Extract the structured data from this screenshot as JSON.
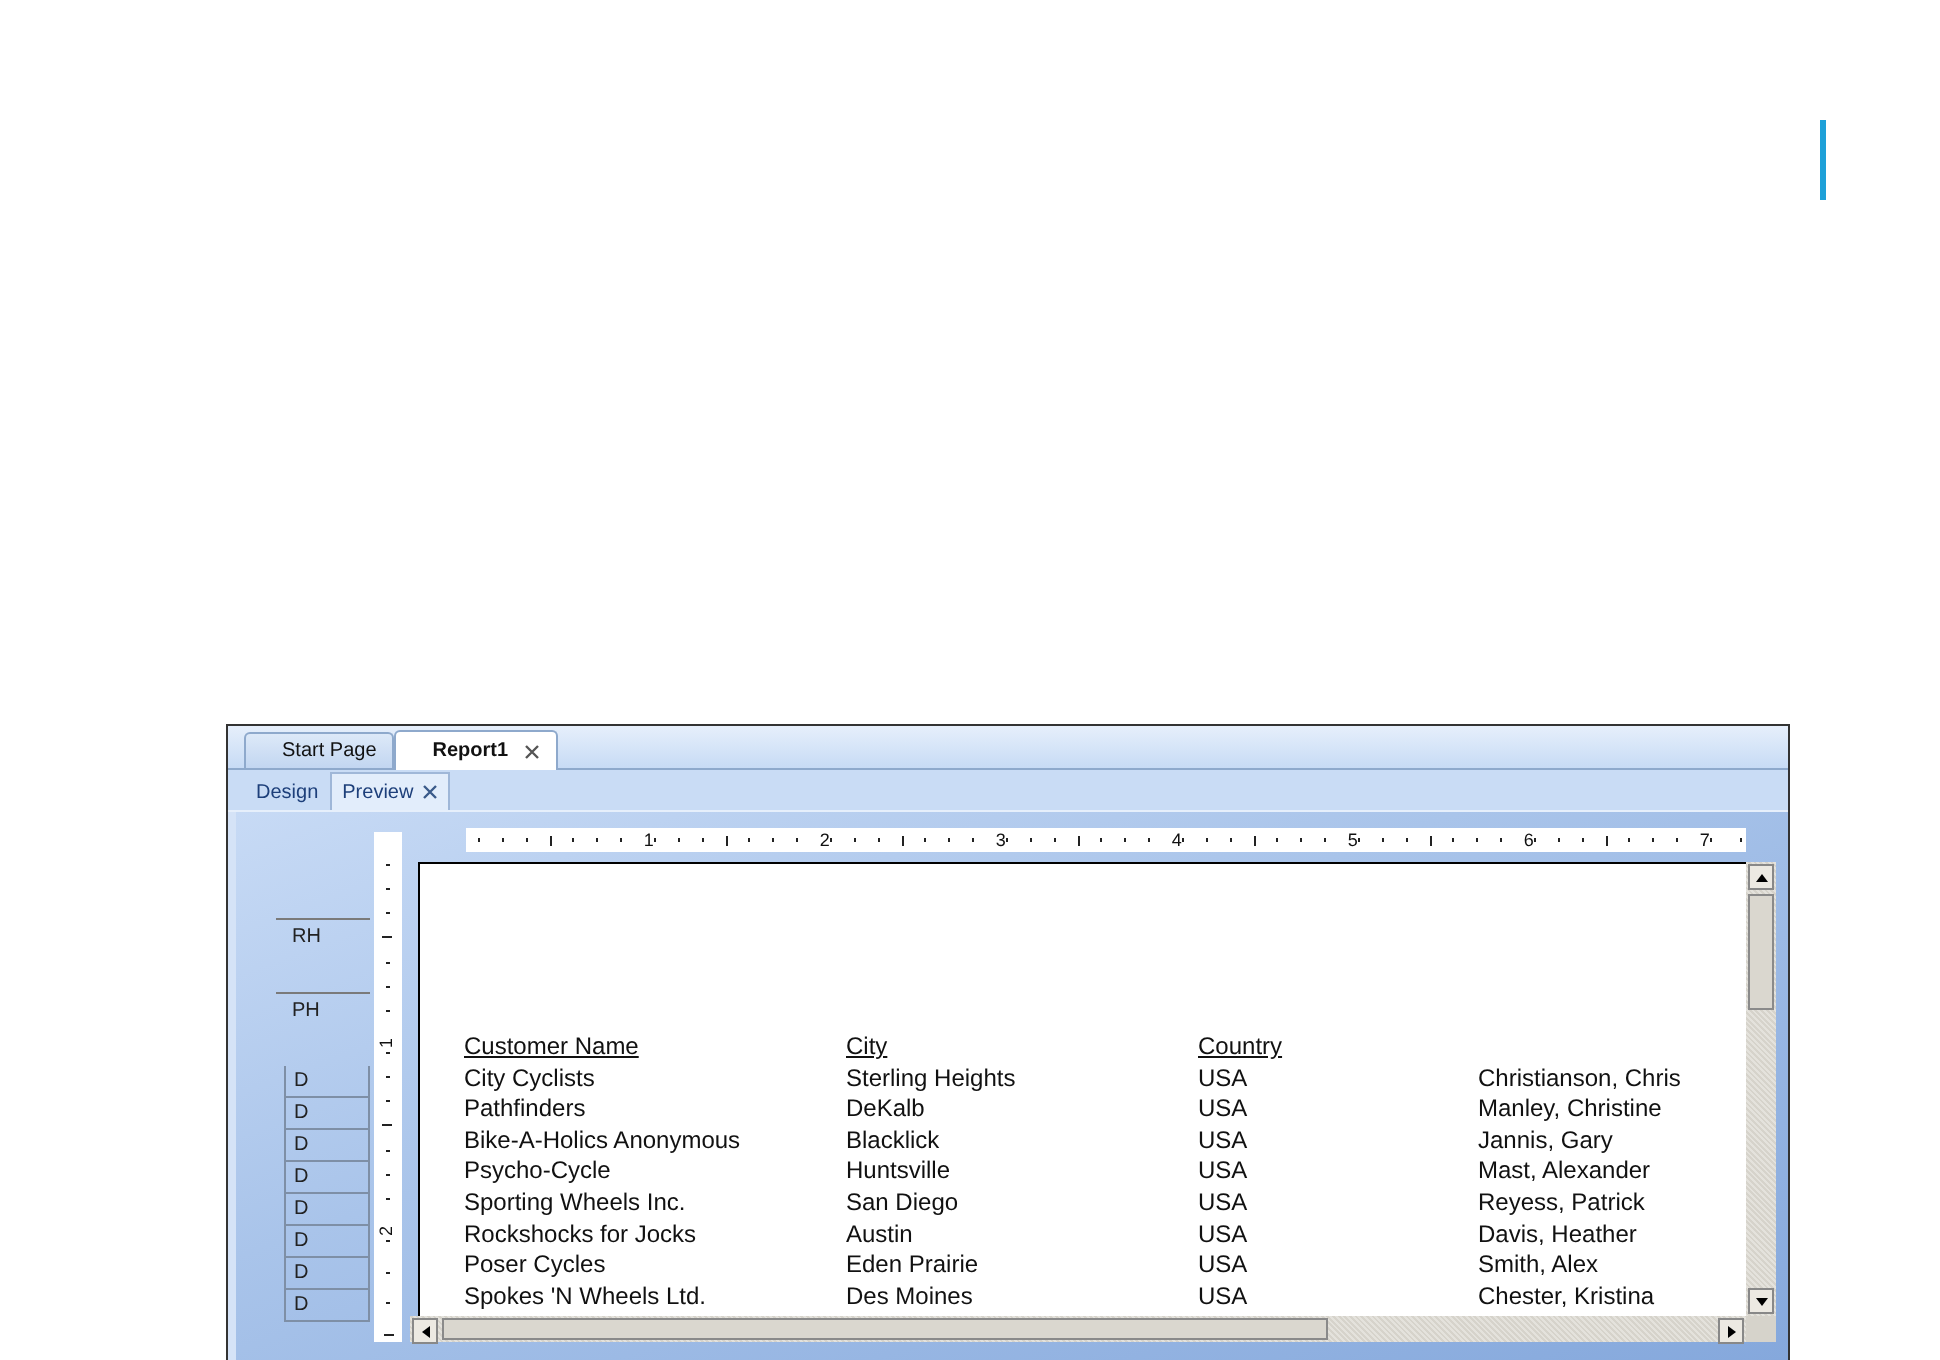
{
  "doc_tabs": [
    {
      "label": "Start Page",
      "selected": false,
      "closable": false
    },
    {
      "label": "Report1",
      "selected": true,
      "closable": true
    }
  ],
  "view_tabs": [
    {
      "label": "Design",
      "selected": false,
      "closable": false
    },
    {
      "label": "Preview",
      "selected": true,
      "closable": true
    }
  ],
  "ruler": {
    "horizontal": [
      "1",
      "2",
      "3",
      "4",
      "5",
      "6",
      "7"
    ],
    "vertical": [
      "1",
      "2"
    ]
  },
  "sections": [
    {
      "label": "RH",
      "kind": "band"
    },
    {
      "label": "PH",
      "kind": "band"
    },
    {
      "label": "D",
      "kind": "row"
    },
    {
      "label": "D",
      "kind": "row"
    },
    {
      "label": "D",
      "kind": "row"
    },
    {
      "label": "D",
      "kind": "row"
    },
    {
      "label": "D",
      "kind": "row"
    },
    {
      "label": "D",
      "kind": "row"
    },
    {
      "label": "D",
      "kind": "row"
    },
    {
      "label": "D",
      "kind": "row"
    }
  ],
  "report": {
    "columns": [
      "Customer Name",
      "City",
      "Country"
    ],
    "rows": [
      [
        "City Cyclists",
        "Sterling Heights",
        "USA",
        "Christianson, Chris"
      ],
      [
        "Pathfinders",
        "DeKalb",
        "USA",
        "Manley, Christine"
      ],
      [
        "Bike-A-Holics Anonymous",
        "Blacklick",
        "USA",
        "Jannis, Gary"
      ],
      [
        "Psycho-Cycle",
        "Huntsville",
        "USA",
        "Mast, Alexander"
      ],
      [
        "Sporting Wheels Inc.",
        "San Diego",
        "USA",
        "Reyess, Patrick"
      ],
      [
        "Rockshocks for Jocks",
        "Austin",
        "USA",
        "Davis, Heather"
      ],
      [
        "Poser Cycles",
        "Eden Prairie",
        "USA",
        "Smith, Alex"
      ],
      [
        "Spokes 'N Wheels Ltd.",
        "Des Moines",
        "USA",
        "Chester, Kristina"
      ]
    ]
  }
}
